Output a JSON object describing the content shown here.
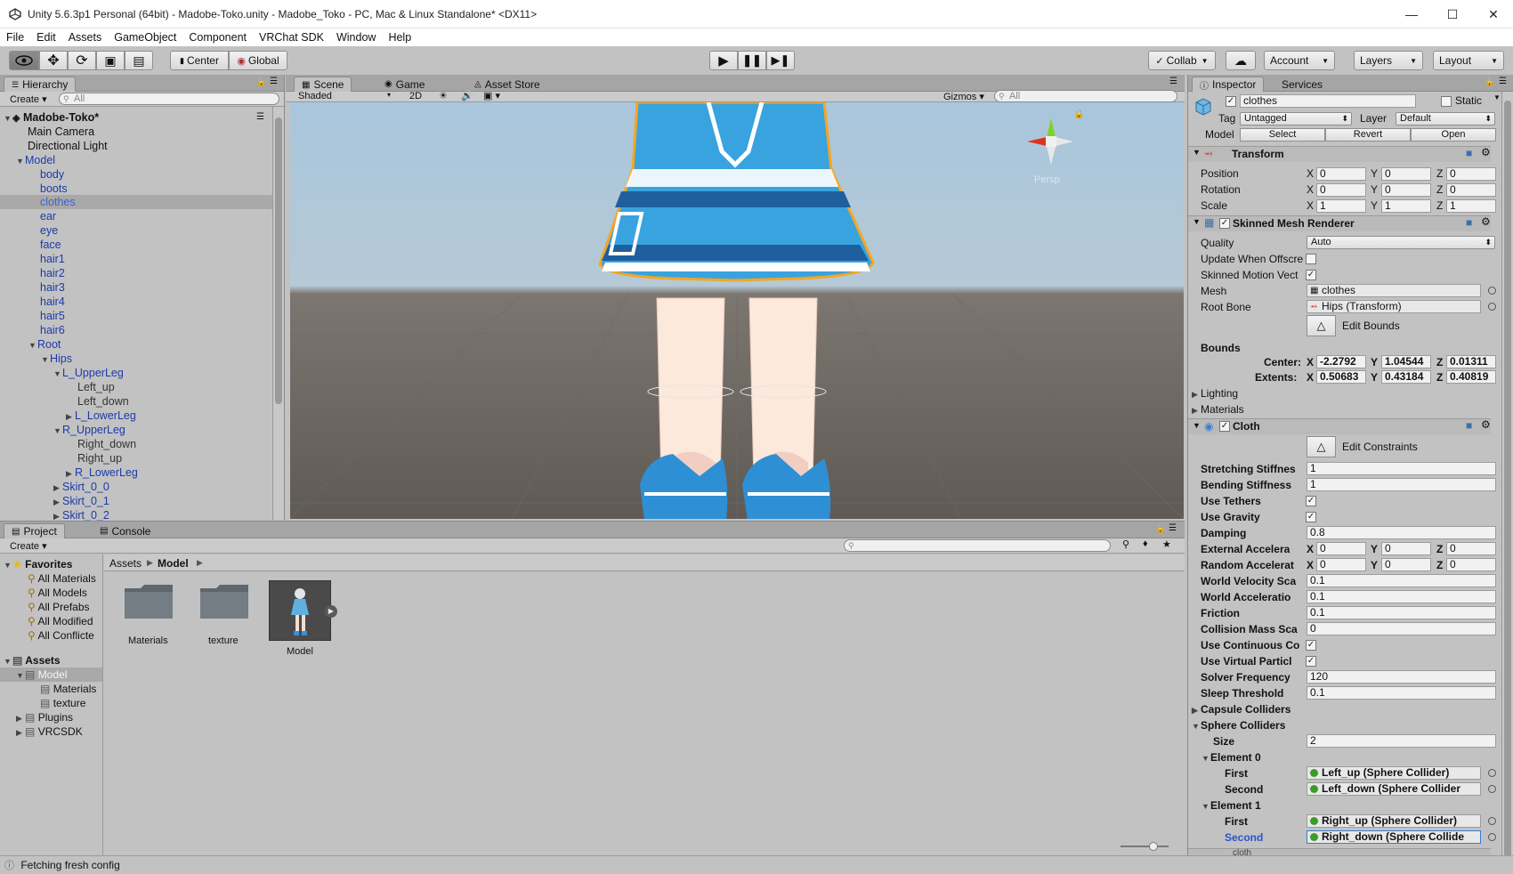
{
  "titlebar": {
    "title": "Unity 5.6.3p1 Personal (64bit) - Madobe-Toko.unity - Madobe_Toko - PC, Mac & Linux Standalone* <DX11>"
  },
  "menubar": {
    "items": [
      "File",
      "Edit",
      "Assets",
      "GameObject",
      "Component",
      "VRChat SDK",
      "Window",
      "Help"
    ]
  },
  "toolbar": {
    "center": "Center",
    "global": "Global",
    "collab": "Collab",
    "account": "Account",
    "layers": "Layers",
    "layout": "Layout"
  },
  "hierarchy": {
    "tab": "Hierarchy",
    "create": "Create",
    "search_placeholder": "All",
    "scene_name": "Madobe-Toko*",
    "items": [
      "Main Camera",
      "Directional Light",
      "Model",
      "body",
      "boots",
      "clothes",
      "ear",
      "eye",
      "face",
      "hair1",
      "hair2",
      "hair3",
      "hair4",
      "hair5",
      "hair6",
      "Root",
      "Hips",
      "L_UpperLeg",
      "Left_up",
      "Left_down",
      "L_LowerLeg",
      "R_UpperLeg",
      "Right_down",
      "Right_up",
      "R_LowerLeg",
      "Skirt_0_0",
      "Skirt_0_1",
      "Skirt_0_2"
    ]
  },
  "scene_view": {
    "tabs": [
      "Scene",
      "Game",
      "Asset Store"
    ],
    "shading": "Shaded",
    "mode_2d": "2D",
    "gizmos": "Gizmos",
    "search_placeholder": "All",
    "persp": "Persp"
  },
  "inspector": {
    "tabs": [
      "Inspector",
      "Services"
    ],
    "object_name": "clothes",
    "static_label": "Static",
    "tag_label": "Tag",
    "tag_value": "Untagged",
    "layer_label": "Layer",
    "layer_value": "Default",
    "model_label": "Model",
    "model_buttons": [
      "Select",
      "Revert",
      "Open"
    ],
    "transform": {
      "title": "Transform",
      "position_label": "Position",
      "position": [
        "0",
        "0",
        "0"
      ],
      "rotation_label": "Rotation",
      "rotation": [
        "0",
        "0",
        "0"
      ],
      "scale_label": "Scale",
      "scale": [
        "1",
        "1",
        "1"
      ]
    },
    "skinned_mesh": {
      "title": "Skinned Mesh Renderer",
      "quality_label": "Quality",
      "quality": "Auto",
      "update_offscreen_label": "Update When Offscre",
      "motion_vectors_label": "Skinned Motion Vect",
      "mesh_label": "Mesh",
      "mesh": "clothes",
      "root_bone_label": "Root Bone",
      "root_bone": "Hips (Transform)",
      "edit_bounds": "Edit Bounds",
      "bounds_label": "Bounds",
      "center_label": "Center:",
      "center": [
        "-2.2792",
        "1.04544",
        "0.01311"
      ],
      "extents_label": "Extents:",
      "extents": [
        "0.50683",
        "0.43184",
        "0.40819"
      ],
      "lighting": "Lighting",
      "materials": "Materials"
    },
    "cloth": {
      "title": "Cloth",
      "edit_constraints": "Edit Constraints",
      "stretching_label": "Stretching Stiffnes",
      "stretching": "1",
      "bending_label": "Bending Stiffness",
      "bending": "1",
      "use_tethers_label": "Use Tethers",
      "use_gravity_label": "Use Gravity",
      "damping_label": "Damping",
      "damping": "0.8",
      "ext_accel_label": "External Accelera",
      "ext_accel": [
        "0",
        "0",
        "0"
      ],
      "rand_accel_label": "Random Accelerat",
      "rand_accel": [
        "0",
        "0",
        "0"
      ],
      "world_vel_label": "World Velocity Sca",
      "world_vel": "0.1",
      "world_accel_label": "World Acceleratio",
      "world_accel": "0.1",
      "friction_label": "Friction",
      "friction": "0.1",
      "collision_mass_label": "Collision Mass Sca",
      "collision_mass": "0",
      "continuous_label": "Use Continuous Co",
      "virtual_label": "Use Virtual Particl",
      "solver_label": "Solver Frequency",
      "solver": "120",
      "sleep_label": "Sleep Threshold",
      "sleep": "0.1",
      "capsule_label": "Capsule Colliders",
      "sphere_label": "Sphere Colliders",
      "size_label": "Size",
      "size": "2",
      "element0_label": "Element 0",
      "element1_label": "Element 1",
      "first_label": "First",
      "second_label": "Second",
      "e0_first": "Left_up (Sphere Collider)",
      "e0_second": "Left_down (Sphere Collider",
      "e1_first": "Right_up (Sphere Collider)",
      "e1_second": "Right_down (Sphere Collide",
      "bottom_partial": "cloth"
    }
  },
  "project": {
    "tabs": [
      "Project",
      "Console"
    ],
    "create": "Create",
    "favorites_label": "Favorites",
    "favorites": [
      "All Materials",
      "All Models",
      "All Prefabs",
      "All Modified",
      "All Conflicte"
    ],
    "assets_label": "Assets",
    "tree": [
      "Model",
      "Materials",
      "texture",
      "Plugins",
      "VRCSDK"
    ],
    "breadcrumb": [
      "Assets",
      "Model"
    ],
    "grid": [
      "Materials",
      "texture",
      "Model"
    ]
  },
  "status": {
    "text": "Fetching fresh config"
  },
  "colors": {
    "accent_blue": "#3a7ed0",
    "selection_outline": "#f5a623",
    "skirt": "#39a3e0"
  }
}
